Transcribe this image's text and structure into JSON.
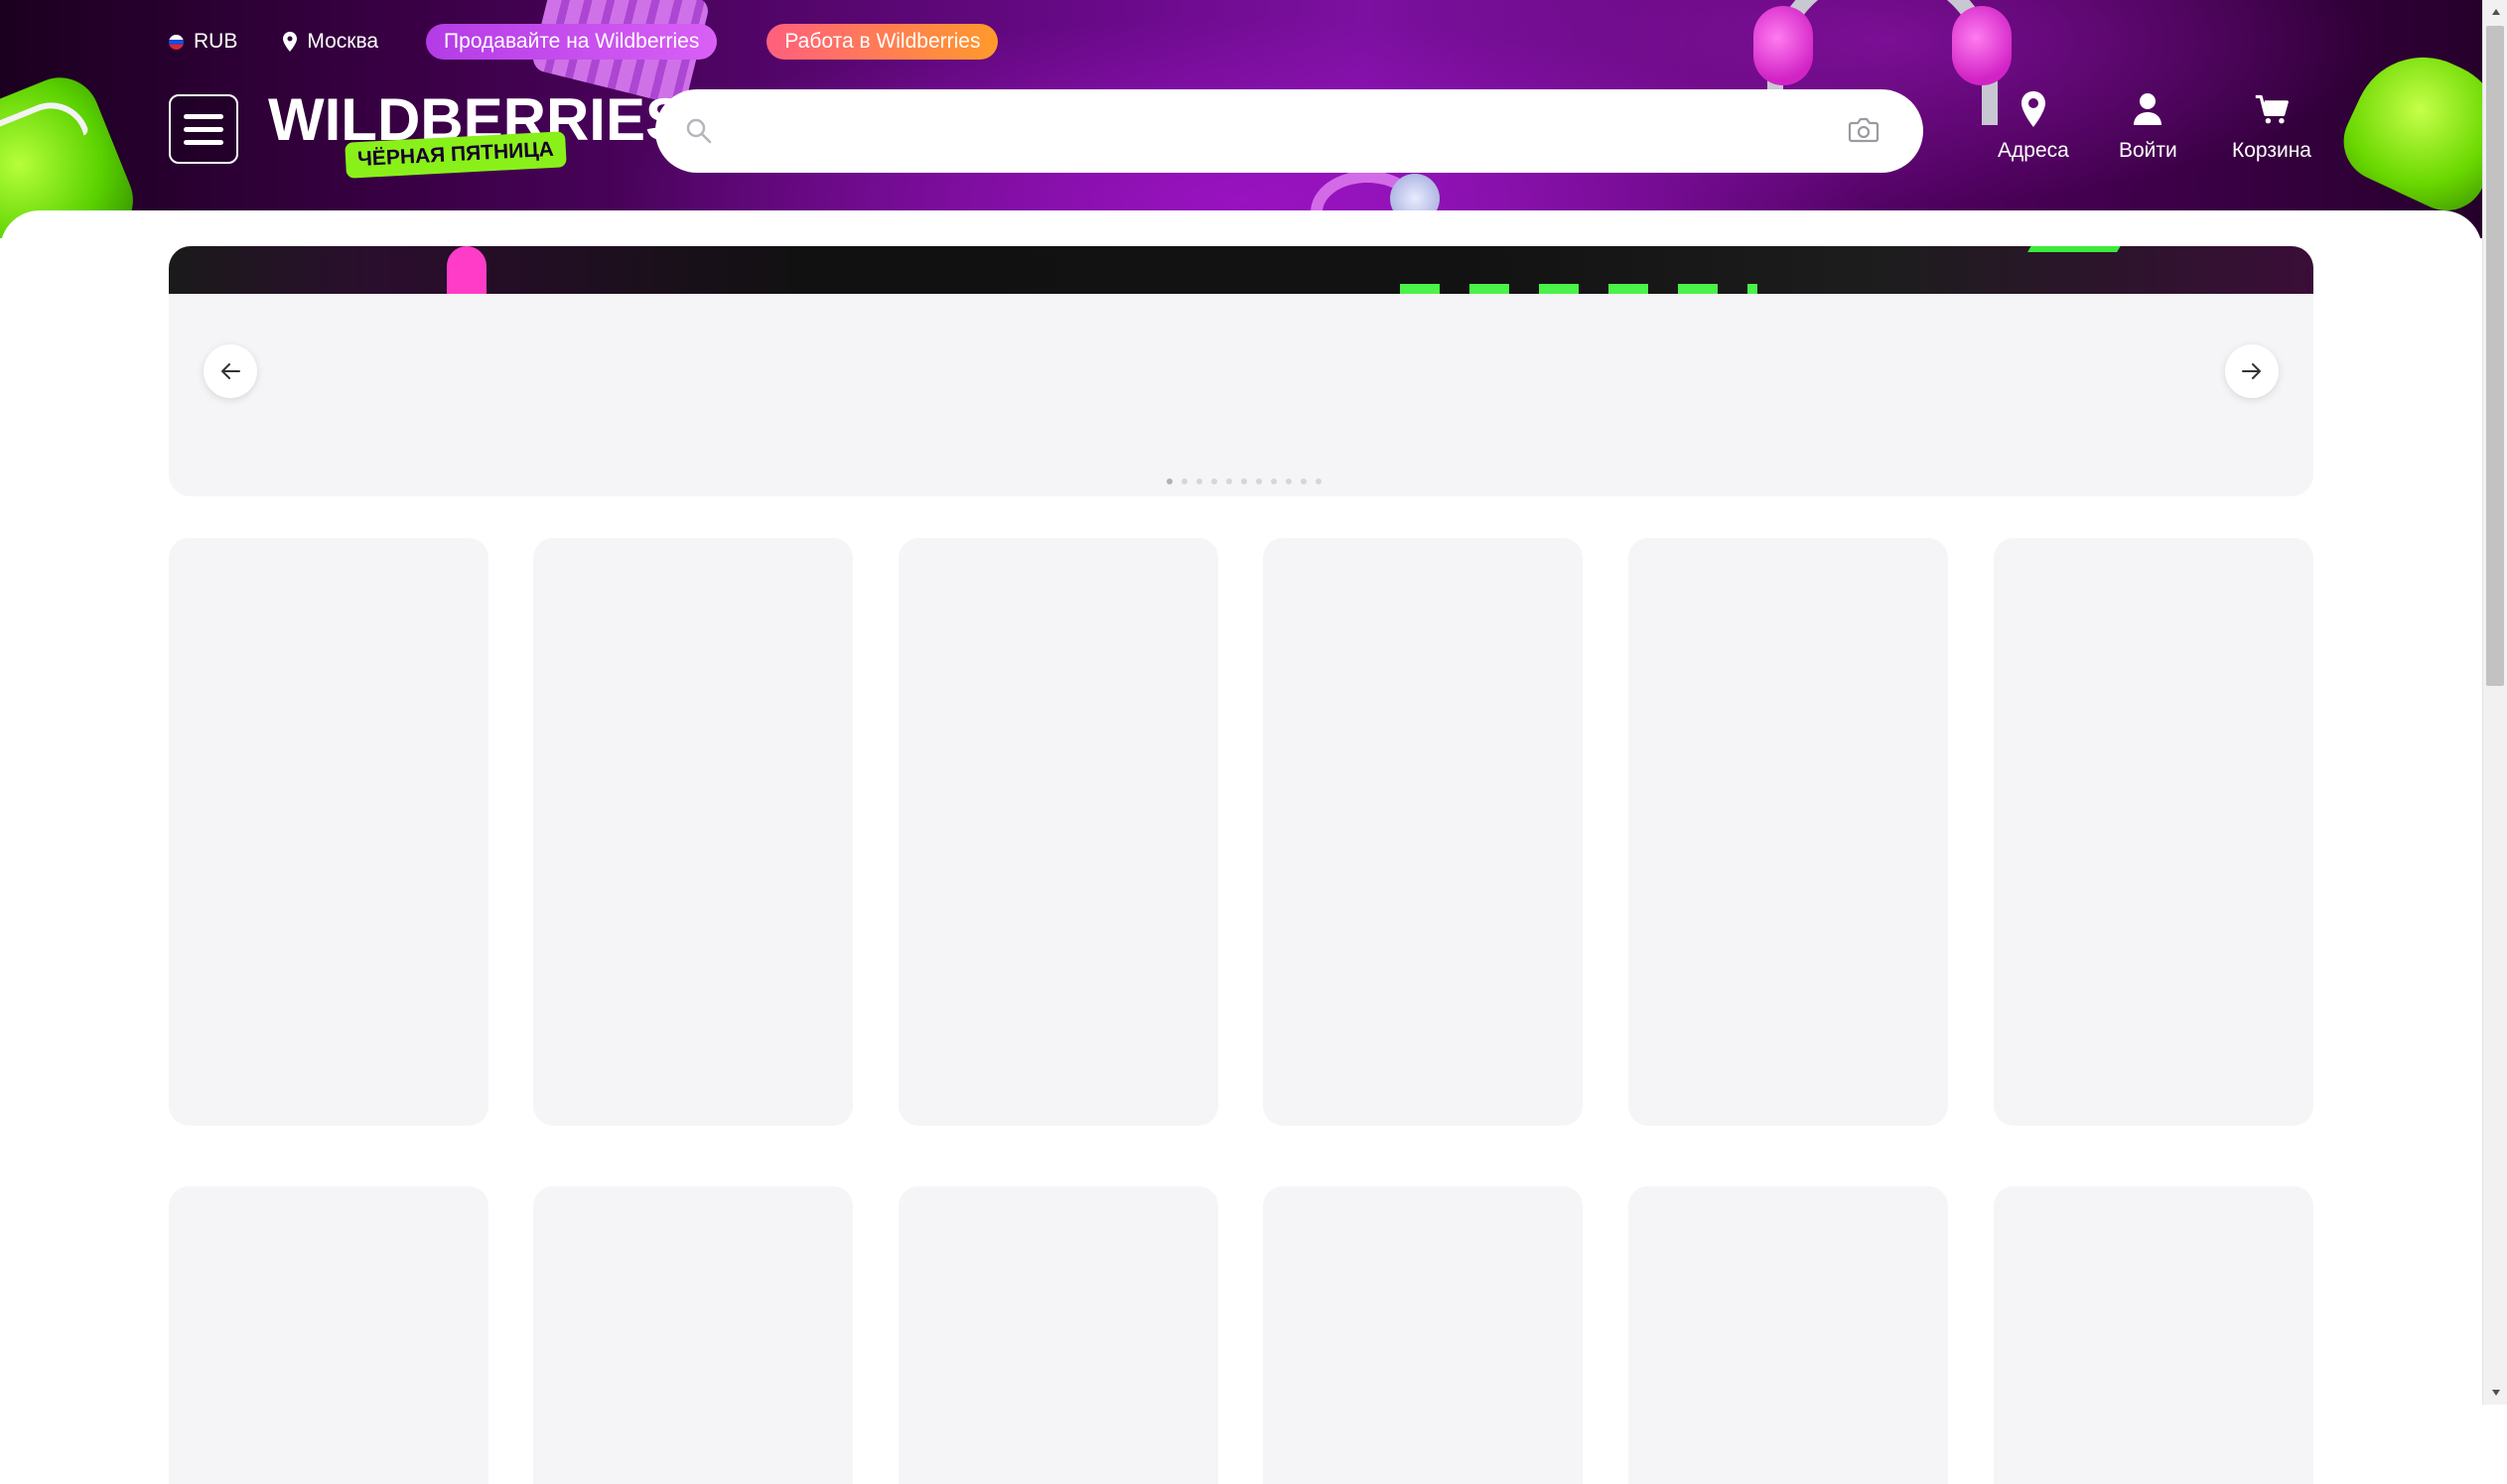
{
  "topbar": {
    "currency": "RUB",
    "city": "Москва",
    "sell_label": "Продавайте на Wildberries",
    "job_label": "Работа в Wildberries"
  },
  "header": {
    "logo_text": "WILDBERRIES",
    "promo_badge": "ЧЁРНАЯ ПЯТНИЦА",
    "search_placeholder": "",
    "search_value": "",
    "nav": {
      "addresses": "Адреса",
      "login": "Войти",
      "cart": "Корзина"
    }
  },
  "banner": {
    "slide_count": 11,
    "active_slide": 1
  },
  "colors": {
    "header_bg": "#6a0a8a",
    "promo_green": "#8af01a",
    "sell_pill": "#b33ce6",
    "job_pill": "#ff7a50",
    "placeholder_gray": "#f5f5f7"
  },
  "icons": [
    "flag-ru-icon",
    "location-pin-icon",
    "menu-icon",
    "search-icon",
    "camera-icon",
    "location-pin-icon",
    "user-icon",
    "cart-icon",
    "arrow-left-icon",
    "arrow-right-icon"
  ]
}
